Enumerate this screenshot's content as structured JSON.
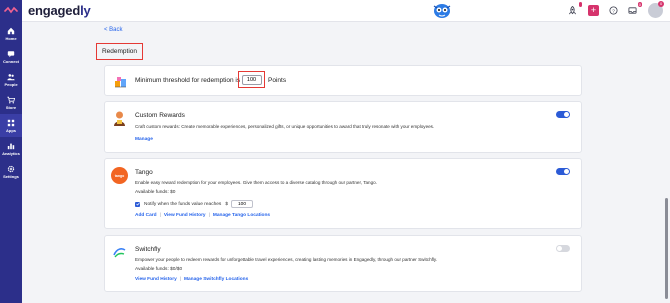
{
  "app": {
    "brand_prefix": "engaged",
    "brand_suffix": "ly"
  },
  "sidebar": {
    "items": [
      {
        "label": "Home",
        "icon": "home-icon"
      },
      {
        "label": "Connect",
        "icon": "chat-icon"
      },
      {
        "label": "People",
        "icon": "people-icon"
      },
      {
        "label": "Store",
        "icon": "cart-icon"
      },
      {
        "label": "Apps",
        "icon": "grid-icon"
      },
      {
        "label": "Analytics",
        "icon": "chart-icon"
      },
      {
        "label": "Settings",
        "icon": "gear-icon"
      }
    ]
  },
  "header": {
    "plus_label": "+",
    "inbox_badge": "0",
    "avatar_badge": "0"
  },
  "back_label": "< Back",
  "page_heading": "Redemption",
  "threshold": {
    "label": "Minimum threshold for redemption is",
    "value": "100",
    "unit": "Points"
  },
  "custom_rewards": {
    "title": "Custom Rewards",
    "description": "Craft custom rewards: Create memorable experiences, personalized gifts, or unique opportunities to award that truly resonate with your employees.",
    "manage_label": "Manage",
    "enabled": true
  },
  "tango": {
    "logo_text": "tango",
    "title": "Tango",
    "description": "Enable easy reward redemption for your employees. Give them access to a diverse catalog through our partner, Tango.",
    "available_funds": "Available funds: $0",
    "notify_label": "Notify when the funds value reaches",
    "currency": "$",
    "notify_value": "100",
    "links": [
      "Add Card",
      "View Fund History",
      "Manage Tango Locations"
    ],
    "enabled": true
  },
  "switchfly": {
    "title": "Switchfly",
    "description": "Empower your people to redeem rewards for unforgettable travel experiences, creating lasting memories in Engagedly, through our partner Switchfly.",
    "available_funds": "Available funds: $0/$0",
    "links": [
      "View Fund History",
      "Manage Switchfly Locations"
    ],
    "enabled": false
  },
  "colors": {
    "sidebar": "#2c2f8a",
    "accent": "#2563eb",
    "highlight": "#e53935",
    "badge": "#d6336c",
    "toggle_on": "#2c5bd6"
  }
}
